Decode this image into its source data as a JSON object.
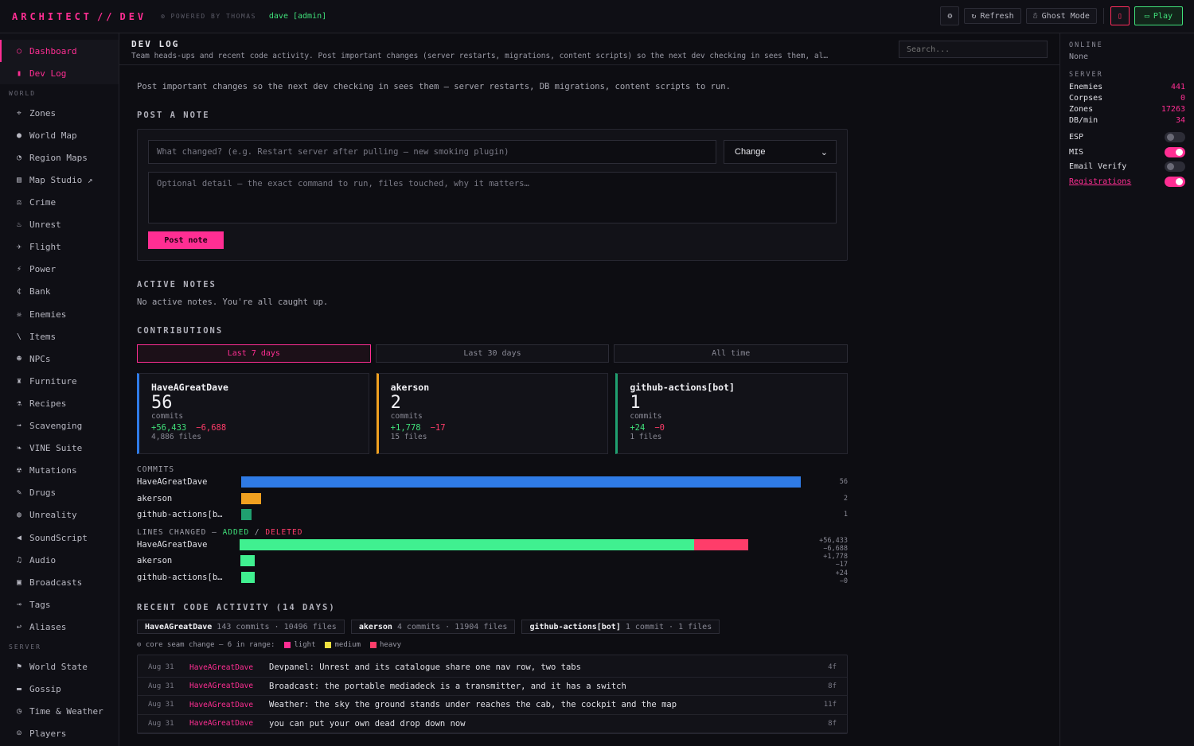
{
  "topbar": {
    "brand_left": "ARCHITECT",
    "brand_sep": "//",
    "brand_right": "DEV",
    "powered": "POWERED BY THOMAS",
    "user": "dave [admin]",
    "refresh": "Refresh",
    "ghost": "Ghost Mode",
    "play": "Play"
  },
  "sidebar": {
    "top": [
      {
        "label": "Dashboard",
        "icon": "○"
      },
      {
        "label": "Dev Log",
        "icon": "▮"
      }
    ],
    "world_title": "WORLD",
    "world": [
      {
        "label": "Zones",
        "icon": "⌖"
      },
      {
        "label": "World Map",
        "icon": "●"
      },
      {
        "label": "Region Maps",
        "icon": "◔"
      },
      {
        "label": "Map Studio ↗",
        "icon": "▤"
      },
      {
        "label": "Crime",
        "icon": "⚖"
      },
      {
        "label": "Unrest",
        "icon": "♨"
      },
      {
        "label": "Flight",
        "icon": "✈"
      },
      {
        "label": "Power",
        "icon": "⚡"
      },
      {
        "label": "Bank",
        "icon": "¢"
      },
      {
        "label": "Enemies",
        "icon": "☠"
      },
      {
        "label": "Items",
        "icon": "\\"
      },
      {
        "label": "NPCs",
        "icon": "☻"
      },
      {
        "label": "Furniture",
        "icon": "♜"
      },
      {
        "label": "Recipes",
        "icon": "⚗"
      },
      {
        "label": "Scavenging",
        "icon": "➟"
      },
      {
        "label": "VINE Suite",
        "icon": "❧"
      },
      {
        "label": "Mutations",
        "icon": "☢"
      },
      {
        "label": "Drugs",
        "icon": "✎"
      },
      {
        "label": "Unreality",
        "icon": "◍"
      },
      {
        "label": "SoundScript",
        "icon": "◀"
      },
      {
        "label": "Audio",
        "icon": "♫"
      },
      {
        "label": "Broadcasts",
        "icon": "▣"
      },
      {
        "label": "Tags",
        "icon": "⊸"
      },
      {
        "label": "Aliases",
        "icon": "↩"
      }
    ],
    "server_title": "SERVER",
    "server": [
      {
        "label": "World State",
        "icon": "⚑"
      },
      {
        "label": "Gossip",
        "icon": "▬"
      },
      {
        "label": "Time & Weather",
        "icon": "◷"
      },
      {
        "label": "Players",
        "icon": "☺"
      }
    ]
  },
  "main": {
    "title": "DEV LOG",
    "subtitle": "Team heads-ups and recent code activity. Post important changes (server restarts, migrations, content scripts) so the next dev checking in sees them, al…",
    "search_placeholder": "Search...",
    "intro": "Post important changes so the next dev checking in sees them — server restarts, DB migrations, content scripts to run.",
    "post_title": "POST A NOTE",
    "what_placeholder": "What changed? (e.g. Restart server after pulling — new smoking plugin)",
    "type_value": "Change",
    "detail_placeholder": "Optional detail — the exact command to run, files touched, why it matters…",
    "post_button": "Post note",
    "active_title": "ACTIVE NOTES",
    "active_empty": "No active notes. You're all caught up.",
    "contrib_title": "CONTRIBUTIONS",
    "tabs": [
      "Last 7 days",
      "Last 30 days",
      "All time"
    ],
    "contributors": [
      {
        "name": "HaveAGreatDave",
        "commits": "56",
        "commits_label": "commits",
        "added": "+56,433",
        "deleted": "−6,688",
        "files": "4,886 files",
        "color": "#2f7be6"
      },
      {
        "name": "akerson",
        "commits": "2",
        "commits_label": "commits",
        "added": "+1,778",
        "deleted": "−17",
        "files": "15 files",
        "color": "#f0a020"
      },
      {
        "name": "github-actions[bot]",
        "commits": "1",
        "commits_label": "commits",
        "added": "+24",
        "deleted": "−0",
        "files": "1 files",
        "color": "#20a070"
      }
    ],
    "commits_chart_title": "COMMITS",
    "lines_chart_title": "LINES CHANGED",
    "lines_sep": "—",
    "lines_added": "ADDED",
    "lines_slash": "/",
    "lines_deleted": "DELETED",
    "recent_title": "RECENT CODE ACTIVITY (14 DAYS)",
    "recent_pills": [
      {
        "name": "HaveAGreatDave",
        "detail": "143 commits · 10496 files"
      },
      {
        "name": "akerson",
        "detail": "4 commits · 11904 files"
      },
      {
        "name": "github-actions[bot]",
        "detail": "1 commit · 1 files"
      }
    ],
    "legend_prefix": "⊙ core seam change — 6 in range:",
    "legend": [
      {
        "label": "light",
        "color": "#ff2e93"
      },
      {
        "label": "medium",
        "color": "#f0e040"
      },
      {
        "label": "heavy",
        "color": "#ff3d6a"
      }
    ],
    "activity": [
      {
        "date": "Aug 31",
        "author": "HaveAGreatDave",
        "msg": "Devpanel: Unrest and its catalogue share one nav row, two tabs",
        "sha": "4f"
      },
      {
        "date": "Aug 31",
        "author": "HaveAGreatDave",
        "msg": "Broadcast: the portable mediadeck is a transmitter, and it has a switch",
        "sha": "8f"
      },
      {
        "date": "Aug 31",
        "author": "HaveAGreatDave",
        "msg": "Weather: the sky the ground stands under reaches the cab, the cockpit and the map",
        "sha": "11f"
      },
      {
        "date": "Aug 31",
        "author": "HaveAGreatDave",
        "msg": "you can put your own dead drop down now",
        "sha": "8f"
      }
    ]
  },
  "chart_data": [
    {
      "type": "bar",
      "title": "COMMITS",
      "categories": [
        "HaveAGreatDave",
        "akerson",
        "github-actions[b…"
      ],
      "values": [
        56,
        2,
        1
      ],
      "value_labels": [
        "56",
        "2",
        "1"
      ],
      "colors": [
        "#2f7be6",
        "#f0a020",
        "#20a070"
      ]
    },
    {
      "type": "bar",
      "title": "LINES CHANGED",
      "categories": [
        "HaveAGreatDave",
        "akerson",
        "github-actions[b…"
      ],
      "series": [
        {
          "name": "ADDED",
          "values": [
            56433,
            1778,
            24
          ],
          "color": "#40f090"
        },
        {
          "name": "DELETED",
          "values": [
            6688,
            17,
            0
          ],
          "color": "#ff3d6a"
        }
      ],
      "value_labels": [
        "+56,433 −6,688",
        "+1,778 −17",
        "+24 −0"
      ]
    }
  ],
  "rpanel": {
    "online_title": "ONLINE",
    "online_value": "None",
    "server_title": "SERVER",
    "stats": [
      {
        "label": "Enemies",
        "value": "441"
      },
      {
        "label": "Corpses",
        "value": "0"
      },
      {
        "label": "Zones",
        "value": "17263"
      },
      {
        "label": "DB/min",
        "value": "34"
      }
    ],
    "toggles": [
      {
        "label": "ESP",
        "on": false
      },
      {
        "label": "MIS",
        "on": true
      },
      {
        "label": "Email Verify",
        "on": false
      },
      {
        "label": "Registrations",
        "on": true
      }
    ]
  }
}
